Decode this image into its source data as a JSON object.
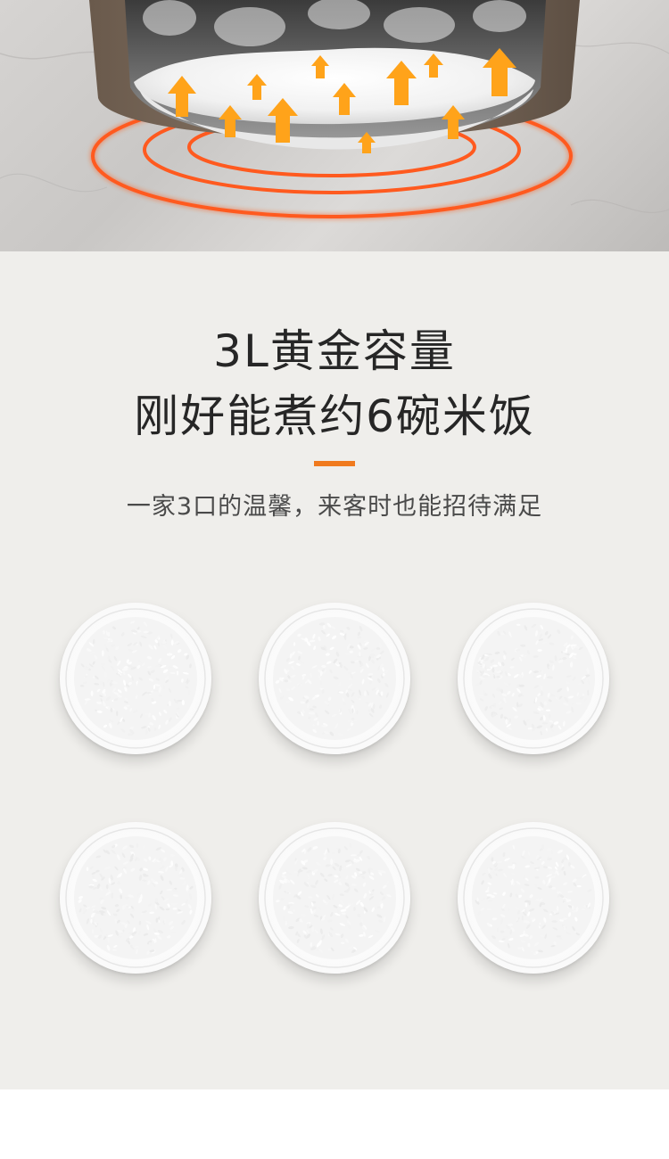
{
  "hero": {
    "image_alt": "rice-cooker-inner-pot-heating",
    "heat_color": "#ff5a1f",
    "arrow_color": "#ffa31a"
  },
  "headline": {
    "line1": "3L黄金容量",
    "line2": "刚好能煮约6碗米饭"
  },
  "accent_color": "#f07a1e",
  "subheadline": "一家3口的温馨，来客时也能招待满足",
  "bowls": [
    {
      "name": "rice-bowl-1"
    },
    {
      "name": "rice-bowl-2"
    },
    {
      "name": "rice-bowl-3"
    },
    {
      "name": "rice-bowl-4"
    },
    {
      "name": "rice-bowl-5"
    },
    {
      "name": "rice-bowl-6"
    }
  ]
}
